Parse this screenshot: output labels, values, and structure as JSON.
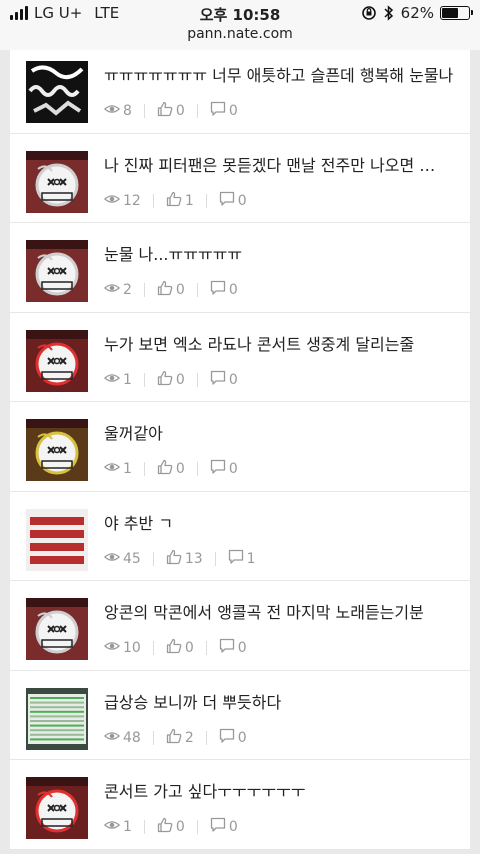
{
  "status_bar": {
    "carrier": "LG U+",
    "network": "LTE",
    "time": "오후 10:58",
    "battery": "62%",
    "battery_level": 0.62,
    "url": "pann.nate.com"
  },
  "items": [
    {
      "title": "ㅠㅠㅠㅠㅠㅠㅠ 너무 애틋하고 슬픈데 행복해 눈물나",
      "views": "8",
      "likes": "0",
      "comments": "0",
      "thumb": "dark-text"
    },
    {
      "title": "나 진짜 피터팬은 못듣겠다 맨날 전주만 나오면 …",
      "views": "12",
      "likes": "1",
      "comments": "0",
      "thumb": "exo"
    },
    {
      "title": "눈물 나...ㅠㅠㅠㅠㅠ",
      "views": "2",
      "likes": "0",
      "comments": "0",
      "thumb": "exo"
    },
    {
      "title": "누가 보면 엑소 라됴나 콘서트 생중계 달리는줄",
      "views": "1",
      "likes": "0",
      "comments": "0",
      "thumb": "exo-red"
    },
    {
      "title": "울꺼같아",
      "views": "1",
      "likes": "0",
      "comments": "0",
      "thumb": "exo-yellow"
    },
    {
      "title": "야 추반 ㄱ",
      "views": "45",
      "likes": "13",
      "comments": "1",
      "thumb": "red-text"
    },
    {
      "title": "앙콘의 막콘에서 앵콜곡 전 마지막 노래듣는기분",
      "views": "10",
      "likes": "0",
      "comments": "0",
      "thumb": "exo"
    },
    {
      "title": "급상승 보니까 더 뿌듯하다",
      "views": "48",
      "likes": "2",
      "comments": "0",
      "thumb": "screen"
    },
    {
      "title": "콘서트 가고 싶다ㅜㅜㅜㅜㅜㅜ",
      "views": "1",
      "likes": "0",
      "comments": "0",
      "thumb": "exo-red"
    }
  ]
}
